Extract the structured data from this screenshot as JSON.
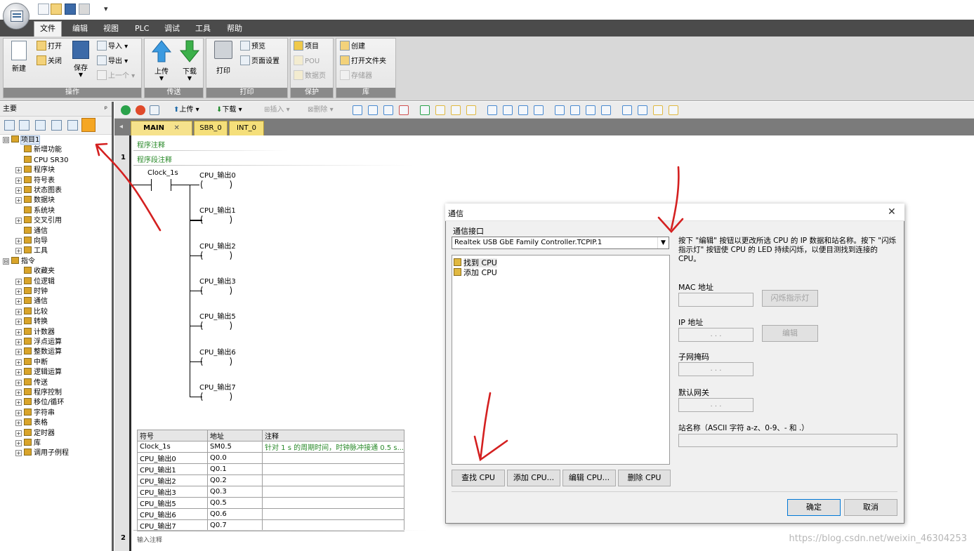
{
  "menu": [
    "文件",
    "编辑",
    "视图",
    "PLC",
    "调试",
    "工具",
    "帮助"
  ],
  "ribbon": {
    "groups": {
      "operation": "操作",
      "transfer": "传送",
      "print": "打印",
      "protect": "保护",
      "library": "库"
    },
    "new": "新建",
    "open": "打开",
    "close": "关闭",
    "save": "保存",
    "import": "导入",
    "export": "导出",
    "previous": "上一个",
    "upload": "上传",
    "download": "下载",
    "print": "打印",
    "preview": "预览",
    "page_setup": "页面设置",
    "project": "项目",
    "pou": "POU",
    "data_page": "数据页",
    "create": "创建",
    "open_folder": "打开文件夹",
    "memory": "存储器"
  },
  "left_panel": {
    "title": "主要",
    "pin": "ᵖ",
    "tree": [
      {
        "label": "项目1",
        "exp": "⊟",
        "level": 0,
        "selected": true
      },
      {
        "label": "新增功能",
        "exp": "",
        "level": 1
      },
      {
        "label": "CPU SR30",
        "exp": "",
        "level": 1
      },
      {
        "label": "程序块",
        "exp": "+",
        "level": 1
      },
      {
        "label": "符号表",
        "exp": "+",
        "level": 1
      },
      {
        "label": "状态图表",
        "exp": "+",
        "level": 1
      },
      {
        "label": "数据块",
        "exp": "+",
        "level": 1
      },
      {
        "label": "系统块",
        "exp": "",
        "level": 1
      },
      {
        "label": "交叉引用",
        "exp": "+",
        "level": 1
      },
      {
        "label": "通信",
        "exp": "",
        "level": 1
      },
      {
        "label": "向导",
        "exp": "+",
        "level": 1
      },
      {
        "label": "工具",
        "exp": "+",
        "level": 1
      },
      {
        "label": "指令",
        "exp": "⊟",
        "level": 0
      },
      {
        "label": "收藏夹",
        "exp": "",
        "level": 1
      },
      {
        "label": "位逻辑",
        "exp": "+",
        "level": 1
      },
      {
        "label": "时钟",
        "exp": "+",
        "level": 1
      },
      {
        "label": "通信",
        "exp": "+",
        "level": 1
      },
      {
        "label": "比较",
        "exp": "+",
        "level": 1
      },
      {
        "label": "转换",
        "exp": "+",
        "level": 1
      },
      {
        "label": "计数器",
        "exp": "+",
        "level": 1
      },
      {
        "label": "浮点运算",
        "exp": "+",
        "level": 1
      },
      {
        "label": "整数运算",
        "exp": "+",
        "level": 1
      },
      {
        "label": "中断",
        "exp": "+",
        "level": 1
      },
      {
        "label": "逻辑运算",
        "exp": "+",
        "level": 1
      },
      {
        "label": "传送",
        "exp": "+",
        "level": 1
      },
      {
        "label": "程序控制",
        "exp": "+",
        "level": 1
      },
      {
        "label": "移位/循环",
        "exp": "+",
        "level": 1
      },
      {
        "label": "字符串",
        "exp": "+",
        "level": 1
      },
      {
        "label": "表格",
        "exp": "+",
        "level": 1
      },
      {
        "label": "定时器",
        "exp": "+",
        "level": 1
      },
      {
        "label": "库",
        "exp": "+",
        "level": 1
      },
      {
        "label": "调用子例程",
        "exp": "+",
        "level": 1
      }
    ]
  },
  "editor_toolbar": {
    "upload": "上传",
    "download": "下载",
    "insert": "插入",
    "delete": "删除"
  },
  "tabs": [
    {
      "label": "MAIN",
      "active": true,
      "close": "✕"
    },
    {
      "label": "SBR_0",
      "active": false
    },
    {
      "label": "INT_0",
      "active": false
    }
  ],
  "editor": {
    "program_comment": "程序注释",
    "network_1_number": "1",
    "network_1_comment": "程序段注释",
    "contact_label": "Clock_1s",
    "coils": [
      "CPU_输出0",
      "CPU_输出1",
      "CPU_输出2",
      "CPU_输出3",
      "CPU_输出5",
      "CPU_输出6",
      "CPU_输出7"
    ],
    "network_2_number": "2",
    "network_2_comment": "输入注释"
  },
  "symbol_table": {
    "headers": [
      "符号",
      "地址",
      "注释"
    ],
    "rows": [
      [
        "Clock_1s",
        "SM0.5",
        "针对 1 s 的周期时间，时钟脉冲接通 0.5 s..."
      ],
      [
        "CPU_输出0",
        "Q0.0",
        ""
      ],
      [
        "CPU_输出1",
        "Q0.1",
        ""
      ],
      [
        "CPU_输出2",
        "Q0.2",
        ""
      ],
      [
        "CPU_输出3",
        "Q0.3",
        ""
      ],
      [
        "CPU_输出5",
        "Q0.5",
        ""
      ],
      [
        "CPU_输出6",
        "Q0.6",
        ""
      ],
      [
        "CPU_输出7",
        "Q0.7",
        ""
      ]
    ]
  },
  "dialog": {
    "title": "通信",
    "close": "✕",
    "interface_label": "通信接口",
    "interface_value": "Realtek USB GbE Family Controller.TCPIP.1",
    "list_items": [
      "找到 CPU",
      "添加 CPU"
    ],
    "help_text": "按下 \"编辑\" 按钮以更改所选 CPU 的 IP 数据和站名称。按下 \"闪烁指示灯\" 按钮使 CPU 的 LED 持续闪烁，以便目测找到连接的 CPU。",
    "mac_label": "MAC 地址",
    "blink_button": "闪烁指示灯",
    "ip_label": "IP 地址",
    "edit_button": "编辑",
    "subnet_label": "子网掩码",
    "gateway_label": "默认网关",
    "ip_placeholder": ". . .",
    "station_label": "站名称（ASCII 字符 a-z、0-9、- 和 .）",
    "find_cpu": "查找 CPU",
    "add_cpu": "添加 CPU...",
    "edit_cpu": "编辑 CPU...",
    "delete_cpu": "删除 CPU",
    "ok": "确定",
    "cancel": "取消"
  },
  "watermark": "https://blog.csdn.net/weixin_46304253",
  "colors": {
    "menubar": "#4b4b4b",
    "tab": "#f5df7a",
    "comment_green": "#2a8a2a",
    "annotation_red": "#d42020"
  }
}
